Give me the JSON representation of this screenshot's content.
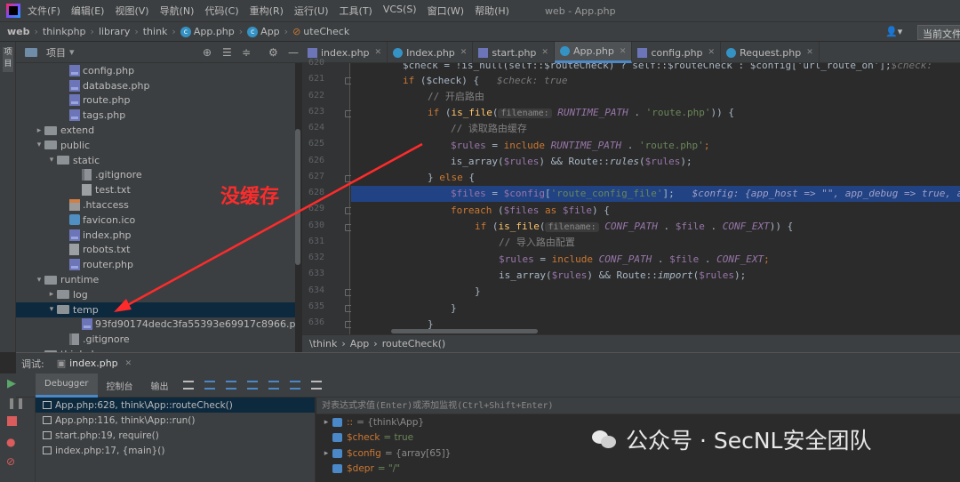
{
  "menubar": {
    "items": [
      "文件(F)",
      "编辑(E)",
      "视图(V)",
      "导航(N)",
      "代码(C)",
      "重构(R)",
      "运行(U)",
      "工具(T)",
      "VCS(S)",
      "窗口(W)",
      "帮助(H)"
    ],
    "window_title": "web - App.php"
  },
  "navbar": {
    "crumbs": [
      "web",
      "thinkphp",
      "library",
      "think",
      "App.php",
      "App",
      "uteCheck"
    ],
    "run_config": "当前文件"
  },
  "sidebar": {
    "strip_label": "项目",
    "header_title": "项目"
  },
  "tree": [
    {
      "label": "config.php",
      "type": "php",
      "indent": 3
    },
    {
      "label": "database.php",
      "type": "php",
      "indent": 3
    },
    {
      "label": "route.php",
      "type": "php",
      "indent": 3
    },
    {
      "label": "tags.php",
      "type": "php",
      "indent": 3
    },
    {
      "label": "extend",
      "type": "folder",
      "indent": 1,
      "arrow": "▸"
    },
    {
      "label": "public",
      "type": "folder",
      "indent": 1,
      "arrow": "▾"
    },
    {
      "label": "static",
      "type": "folder",
      "indent": 2,
      "arrow": "▾"
    },
    {
      "label": ".gitignore",
      "type": "git",
      "indent": 4
    },
    {
      "label": "test.txt",
      "type": "txt",
      "indent": 4
    },
    {
      "label": ".htaccess",
      "type": "hta",
      "indent": 3
    },
    {
      "label": "favicon.ico",
      "type": "ico",
      "indent": 3
    },
    {
      "label": "index.php",
      "type": "php",
      "indent": 3
    },
    {
      "label": "robots.txt",
      "type": "txt",
      "indent": 3
    },
    {
      "label": "router.php",
      "type": "php",
      "indent": 3
    },
    {
      "label": "runtime",
      "type": "folder",
      "indent": 1,
      "arrow": "▾"
    },
    {
      "label": "log",
      "type": "folder",
      "indent": 2,
      "arrow": "▸"
    },
    {
      "label": "temp",
      "type": "folder",
      "indent": 2,
      "arrow": "▾",
      "selected": true
    },
    {
      "label": "93fd90174dedc3fa55393e69917c8966.php",
      "type": "php",
      "indent": 4
    },
    {
      "label": ".gitignore",
      "type": "git",
      "indent": 3
    },
    {
      "label": "thinkphp",
      "type": "folder",
      "indent": 1,
      "arrow": "▸"
    }
  ],
  "tabs": [
    {
      "label": "index.php",
      "icon": "php"
    },
    {
      "label": "Index.php",
      "icon": "c"
    },
    {
      "label": "start.php",
      "icon": "php"
    },
    {
      "label": "App.php",
      "icon": "c",
      "active": true
    },
    {
      "label": "config.php",
      "icon": "php"
    },
    {
      "label": "Request.php",
      "icon": "c"
    }
  ],
  "gutter": {
    "lines": [
      "620",
      "621",
      "622",
      "623",
      "624",
      "625",
      "626",
      "627",
      "628",
      "629",
      "630",
      "631",
      "632",
      "633",
      "634",
      "635",
      "636"
    ]
  },
  "code_text": {
    "l620": "$check = !is_null(self::$routeCheck) ? self::$routeCheck : $config['url_route_on'];",
    "l620_hint": "$check:",
    "l621_if": "if",
    "l621_rest": " ($check) {",
    "l621_hint": "$check: true",
    "l622": "// 开启路由",
    "l623_if": "if",
    "l623_a": " (",
    "l623_fn": "is_file",
    "l623_b": "(",
    "l623_ph": "filename:",
    "l623_const": "RUNTIME_PATH",
    "l623_c": " . ",
    "l623_str": "'route.php'",
    "l623_d": ")) {",
    "l624": "// 读取路由缓存",
    "l625_var": "$rules",
    "l625_a": " = ",
    "l625_kw": "include",
    "l625_const": " RUNTIME_PATH",
    "l625_b": " . ",
    "l625_str": "'route.php'",
    "l625_c": ";",
    "l626_a": "is_array(",
    "l626_var": "$rules",
    "l626_b": ") && Route::",
    "l626_fn": "rules",
    "l626_c": "(",
    "l626_var2": "$rules",
    "l626_d": ");",
    "l627_a": "} ",
    "l627_kw": "else",
    "l627_b": " {",
    "l628_var": "$files",
    "l628_a": " = ",
    "l628_var2": "$config",
    "l628_b": "[",
    "l628_str": "'route_config_file'",
    "l628_c": "];",
    "l628_hint": "$config: {app_host => \"\", app_debug => true, app_tr",
    "l629_kw": "foreach",
    "l629_a": " (",
    "l629_var": "$files",
    "l629_kw2": " as ",
    "l629_var2": "$file",
    "l629_b": ") {",
    "l630_if": "if",
    "l630_a": " (",
    "l630_fn": "is_file",
    "l630_b": "(",
    "l630_ph": "filename:",
    "l630_const": "CONF_PATH",
    "l630_c": " . ",
    "l630_var": "$file",
    "l630_d": " . ",
    "l630_const2": "CONF_EXT",
    "l630_e": ")) {",
    "l631": "// 导入路由配置",
    "l632_var": "$rules",
    "l632_a": " = ",
    "l632_kw": "include",
    "l632_const": " CONF_PATH",
    "l632_b": " . ",
    "l632_var2": "$file",
    "l632_c": " . ",
    "l632_const2": "CONF_EXT",
    "l632_d": ";",
    "l633_a": "is_array(",
    "l633_var": "$rules",
    "l633_b": ") && Route::",
    "l633_fn": "import",
    "l633_c": "(",
    "l633_var2": "$rules",
    "l633_d": ");",
    "l634": "}",
    "l635": "}",
    "l636": "}"
  },
  "code_breadcrumb": [
    "\\think",
    "App",
    "routeCheck()"
  ],
  "debug": {
    "label": "调试:",
    "session": "index.php",
    "tabs": [
      "Debugger",
      "控制台",
      "输出"
    ],
    "frames": [
      {
        "text": "App.php:628, think\\App::routeCheck()",
        "selected": true
      },
      {
        "text": "App.php:116, think\\App::run()"
      },
      {
        "text": "start.php:19, require()"
      },
      {
        "text": "index.php:17, {main}()"
      }
    ],
    "eval_placeholder": "对表达式求值(Enter)或添加监视(Ctrl+Shift+Enter)",
    "vars": [
      {
        "name": "::",
        "value": "= {think\\App}",
        "arrow": "▸"
      },
      {
        "name": "$check",
        "value": "= true",
        "arrow": ""
      },
      {
        "name": "$config",
        "value": "= {array[65]}",
        "arrow": "▸"
      },
      {
        "name": "$depr",
        "value": "= \"/\"",
        "arrow": ""
      }
    ]
  },
  "annotation": {
    "text": "没缓存",
    "color": "#ff2b2b"
  },
  "watermark": {
    "text": "公众号 · SecNL安全团队"
  },
  "colors": {
    "accent": "#4a88c7",
    "selection": "#214283",
    "keyword": "#cc7832",
    "string": "#6a8759",
    "variable": "#9876aa"
  }
}
